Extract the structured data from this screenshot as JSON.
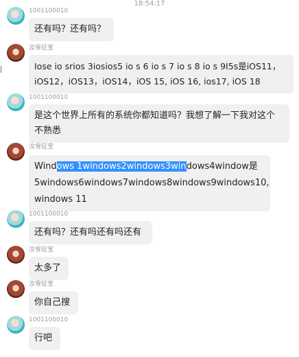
{
  "timestamp": "18:54:17",
  "messages": [
    {
      "sender": "1001100010",
      "avatar": "teal-haired-girl",
      "text": "还有吗？还有吗？"
    },
    {
      "sender": "汝雪征宝",
      "avatar": "brown-haired-girl",
      "lines": [
        "Iose io srios 3iosios5 io s 6 io s 7 io s 8 io s 9I5s是iOS11，",
        "iOS12，iOS13，iOS14，iOS 15, iOS 16, ios17, iOS 18"
      ]
    },
    {
      "sender": "1001100010",
      "avatar": "teal-haired-girl",
      "lines": [
        "是这个世界上所有的系统你都知道吗？我想了解一下我对这个",
        "不熟悉"
      ]
    },
    {
      "sender": "汝雪征宝",
      "avatar": "brown-haired-girl",
      "line1_before": "Wind",
      "line1_selected": "ows 1windows2windows3win",
      "line1_after": "dows4window是",
      "lines": [
        "5windows6windows7windows8windows9windows10,",
        "windows 11"
      ]
    },
    {
      "sender": "1001100010",
      "avatar": "teal-haired-girl",
      "text": "还有吗？还有吗还有吗还有"
    },
    {
      "sender": "汝雪征宝",
      "avatar": "brown-haired-girl",
      "text": "太多了"
    },
    {
      "sender": "汝雪征宝",
      "avatar": "brown-haired-girl",
      "text": "你自己搜"
    },
    {
      "sender": "1001100010",
      "avatar": "teal-haired-girl",
      "text": "行吧"
    }
  ]
}
